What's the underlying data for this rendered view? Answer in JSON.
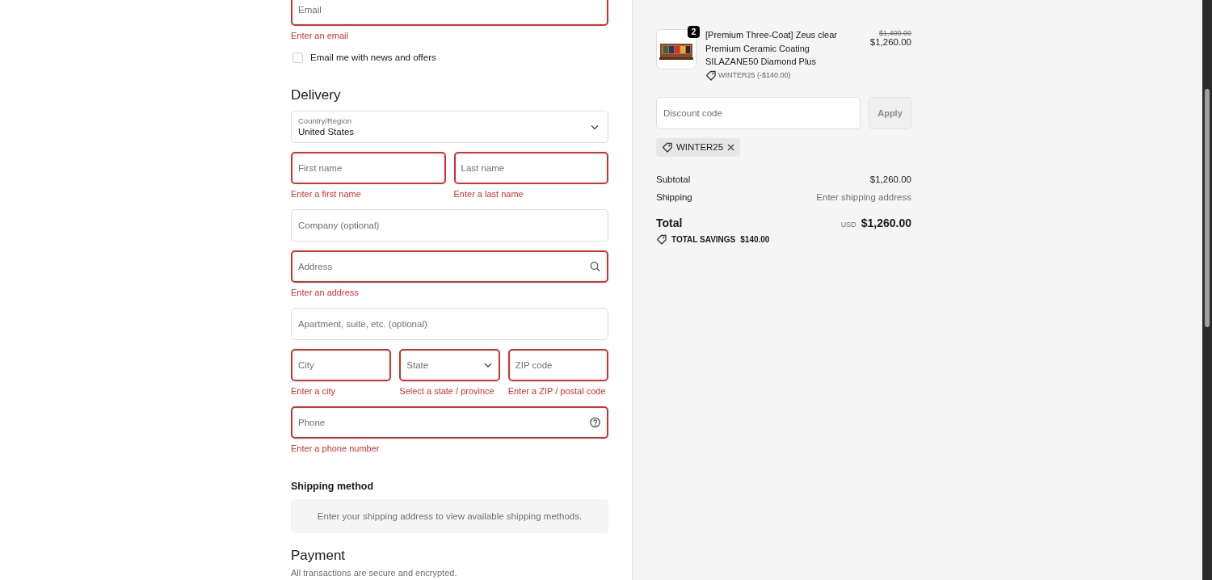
{
  "contact": {
    "email": {
      "placeholder": "Email",
      "invalid": true,
      "error": "Enter an email"
    },
    "newsletter": {
      "label": "Email me with news and offers",
      "checked": false
    }
  },
  "delivery": {
    "heading": "Delivery",
    "country": {
      "label": "Country/Region",
      "value": "United States"
    },
    "rows": [
      [
        {
          "kind": "text",
          "placeholder": "First name",
          "invalid": true,
          "error": "Enter a first name"
        },
        {
          "kind": "text",
          "placeholder": "Last name",
          "invalid": true,
          "error": "Enter a last name"
        }
      ],
      [
        {
          "kind": "text",
          "placeholder": "Company (optional)",
          "invalid": false
        }
      ],
      [
        {
          "kind": "search",
          "placeholder": "Address",
          "invalid": true,
          "error": "Enter an address"
        }
      ],
      [
        {
          "kind": "text",
          "placeholder": "Apartment, suite, etc. (optional)",
          "invalid": false
        }
      ],
      [
        {
          "kind": "text",
          "placeholder": "City",
          "invalid": true,
          "error": "Enter a city"
        },
        {
          "kind": "select",
          "placeholder": "State",
          "invalid": true,
          "error": "Select a state / province"
        },
        {
          "kind": "text",
          "placeholder": "ZIP code",
          "invalid": true,
          "error": "Enter a ZIP / postal code"
        }
      ],
      [
        {
          "kind": "help",
          "placeholder": "Phone",
          "invalid": true,
          "error": "Enter a phone number"
        }
      ]
    ]
  },
  "shipping_method": {
    "heading": "Shipping method",
    "message": "Enter your shipping address to view available shipping methods."
  },
  "payment": {
    "heading": "Payment",
    "note": "All transactions are secure and encrypted."
  },
  "summary": {
    "item": {
      "quantity": "2",
      "title": "[Premium Three-Coat] Zeus clear Premium Ceramic Coating SILAZANE50 Diamond Plus",
      "discount": "WINTER25 (-$140.00)",
      "original_price": "$1,400.00",
      "price": "$1,260.00"
    },
    "discount_field": {
      "placeholder": "Discount code"
    },
    "apply_button": {
      "label": "Apply",
      "disabled": true
    },
    "applied_codes": [
      {
        "code": "WINTER25"
      }
    ],
    "lines": [
      {
        "label": "Subtotal",
        "value": "$1,260.00",
        "muted": false
      },
      {
        "label": "Shipping",
        "value": "Enter shipping address",
        "muted": true
      }
    ],
    "total": {
      "label": "Total",
      "currency": "USD",
      "value": "$1,260.00"
    },
    "savings": {
      "label": "TOTAL SAVINGS",
      "value": "$140.00"
    }
  }
}
